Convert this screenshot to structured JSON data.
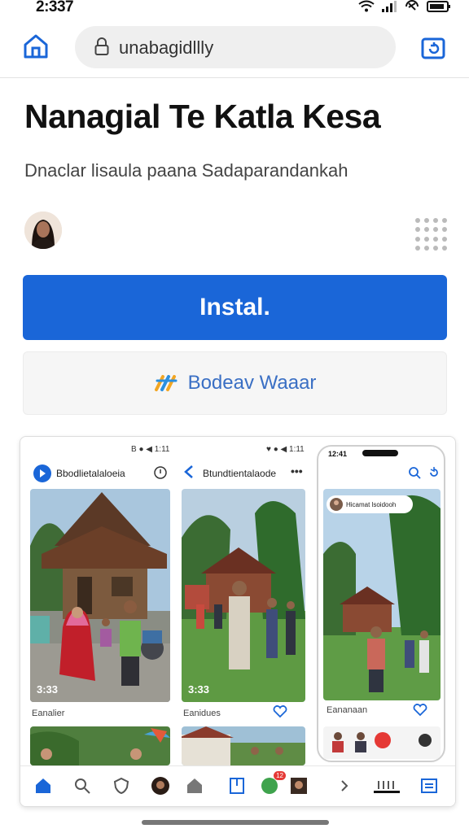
{
  "status_bar": {
    "time": "2:337"
  },
  "browser": {
    "url": "unabagidllly"
  },
  "listing": {
    "title": "Nanagial Te Katla Kesa",
    "subtitle": "Dnaclar lisaula paana Sadaparandankah",
    "install_label": "Instal.",
    "secondary_label": "Bodeav Waaar"
  },
  "screenshot": {
    "left_status": "B ● ◀ 1:11",
    "left_title": "Bbodlietalaloeia",
    "mid_status": "♥ ● ◀ 1:11",
    "mid_title": "Btundtientalaode",
    "phone_time": "12:41",
    "phone_banner": "Hicamat lsoidooh",
    "timecode_1": "3:33",
    "timecode_2": "3:33",
    "caption_1": "Eanalier",
    "caption_2": "Eanidues",
    "caption_3": "Eananaan",
    "badge": "12"
  },
  "colors": {
    "accent": "#1a66d8",
    "secondary_text": "#3a6fc4"
  },
  "icons": [
    "home-icon",
    "lock-icon",
    "tabs-icon",
    "wifi-icon",
    "signal-icon",
    "battery-icon",
    "search-icon",
    "heart-icon",
    "more-icon",
    "back-icon",
    "shield-icon",
    "bookmark-icon",
    "list-icon",
    "menu-icon"
  ]
}
